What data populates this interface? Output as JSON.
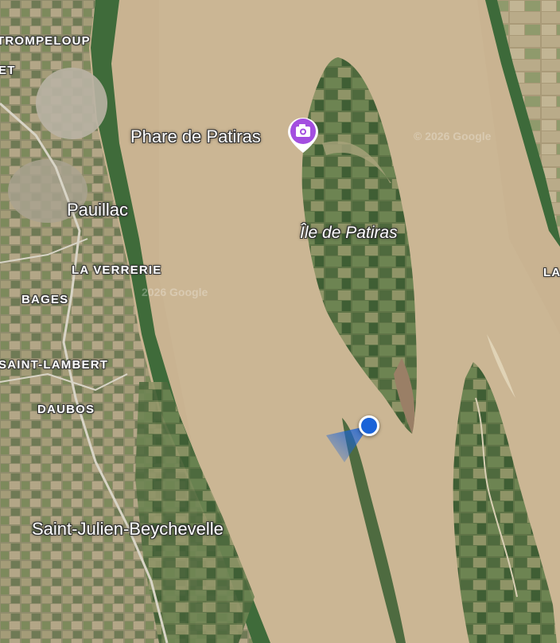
{
  "map": {
    "places": {
      "trompeloup": "TROMPELOUP",
      "et": "ET",
      "pauillac": "Pauillac",
      "la_verrerie": "LA VERRERIE",
      "bages": "BAGES",
      "saint_lambert": "SAINT-LAMBERT",
      "daubos": "DAUBOS",
      "saint_julien": "Saint-Julien-Beychevelle",
      "la_edge": "LA"
    },
    "poi": {
      "name": "Phare de Patiras",
      "icon": "camera-icon",
      "color": "#a34ee0"
    },
    "island_label": "Île de Patiras",
    "watermarks": [
      "© 2026 Google",
      "2026 Google"
    ],
    "location_marker": {
      "color": "#1a63d8"
    },
    "colors": {
      "water": "#c9b391",
      "land": "#8e8a6a",
      "vegetation": "#3f6b3a"
    }
  }
}
